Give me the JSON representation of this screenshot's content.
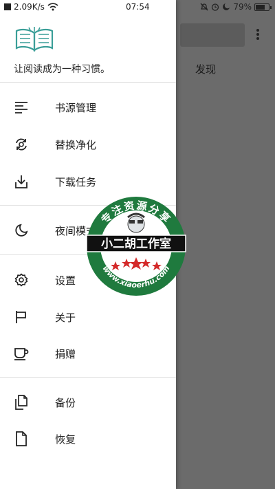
{
  "status_bar": {
    "speed": "2.09K/s",
    "time": "07:54",
    "battery_percent": "79%",
    "battery_level": 0.79
  },
  "background": {
    "tab_label": "发现"
  },
  "drawer": {
    "slogan": "让阅读成为一种习惯。",
    "items": [
      {
        "label": "书源管理",
        "icon": "list-icon"
      },
      {
        "label": "替换净化",
        "icon": "replace-icon"
      },
      {
        "label": "下载任务",
        "icon": "download-icon"
      },
      {
        "label": "夜间模式",
        "icon": "moon-icon"
      },
      {
        "label": "设置",
        "icon": "gear-icon"
      },
      {
        "label": "关于",
        "icon": "flag-icon"
      },
      {
        "label": "捐赠",
        "icon": "coffee-icon"
      },
      {
        "label": "备份",
        "icon": "backup-icon"
      },
      {
        "label": "恢复",
        "icon": "file-icon"
      }
    ]
  },
  "watermark": {
    "top_text": "专注资源分享",
    "banner_text": "小二胡工作室",
    "url_text": "www.xiaoerhu.com"
  },
  "colors": {
    "accent_teal": "#3a9e98",
    "watermark_green": "#1f7a3e",
    "watermark_red": "#d42a2a"
  }
}
